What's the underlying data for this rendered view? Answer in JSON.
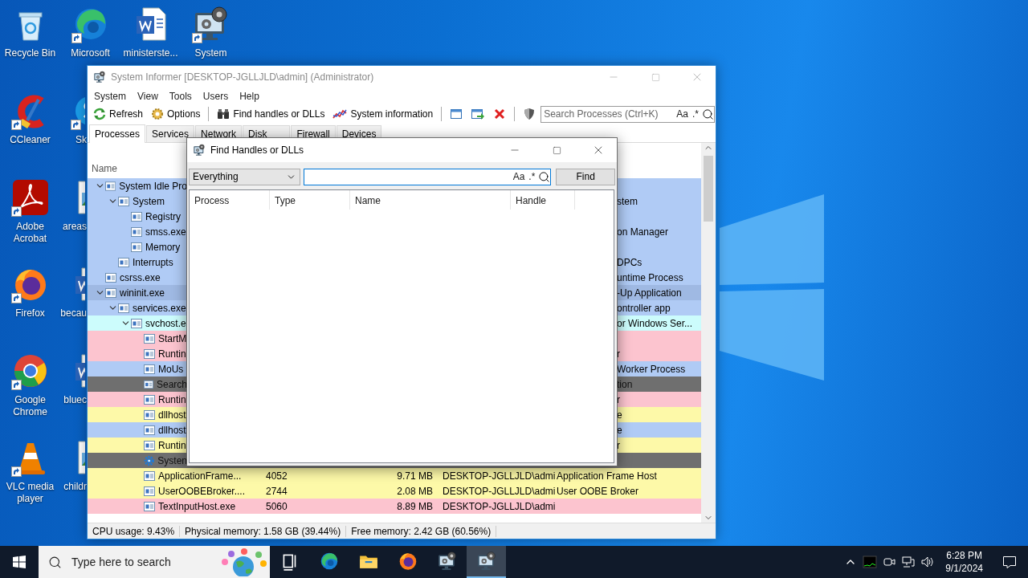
{
  "desktop_columns": [
    [
      {
        "label": "Recycle Bin",
        "kind": "recycle",
        "shortcut": false,
        "partial": false
      },
      {
        "label": "CCleaner",
        "kind": "ccleaner",
        "shortcut": true,
        "partial": false
      },
      {
        "label": "Adobe Acrobat",
        "kind": "acrobat",
        "shortcut": true,
        "partial": false
      },
      {
        "label": "Firefox",
        "kind": "firefox",
        "shortcut": true,
        "partial": false
      },
      {
        "label": "Google Chrome",
        "kind": "chrome",
        "shortcut": true,
        "partial": false
      },
      {
        "label": "VLC media player",
        "kind": "vlc",
        "shortcut": true,
        "partial": false
      }
    ],
    [
      {
        "label": "Microsoft",
        "kind": "edge",
        "shortcut": true,
        "partial": false
      },
      {
        "label": "Sk",
        "kind": "skype",
        "shortcut": true,
        "partial": true
      },
      {
        "label": "areas",
        "kind": "image",
        "shortcut": false,
        "partial": true
      },
      {
        "label": "becau",
        "kind": "word",
        "shortcut": false,
        "partial": true
      },
      {
        "label": "bluec",
        "kind": "word",
        "shortcut": false,
        "partial": true
      },
      {
        "label": "childr",
        "kind": "image",
        "shortcut": false,
        "partial": true
      }
    ],
    [
      {
        "label": "ministerste...",
        "kind": "word",
        "shortcut": false,
        "partial": false
      }
    ],
    [
      {
        "label": "System",
        "kind": "sysinformer",
        "shortcut": true,
        "partial": false
      }
    ]
  ],
  "main_window": {
    "title": "System Informer [DESKTOP-JGLLJLD\\admin] (Administrator)",
    "menu": [
      "System",
      "View",
      "Tools",
      "Users",
      "Help"
    ],
    "toolbar": [
      {
        "kind": "refresh",
        "label": "Refresh"
      },
      {
        "kind": "options",
        "label": "Options"
      },
      {
        "kind": "separator"
      },
      {
        "kind": "find",
        "label": "Find handles or DLLs"
      },
      {
        "kind": "sysinfo",
        "label": "System information"
      },
      {
        "kind": "separator"
      },
      {
        "kind": "window"
      },
      {
        "kind": "window-go"
      },
      {
        "kind": "terminate"
      },
      {
        "kind": "separator"
      },
      {
        "kind": "shield"
      }
    ],
    "search": {
      "placeholder": "Search Processes (Ctrl+K)",
      "options": [
        "Aa",
        ".*"
      ]
    },
    "tabs": [
      {
        "label": "Processes",
        "selected": true
      },
      {
        "label": "Services",
        "selected": false
      },
      {
        "label": "Network",
        "selected": false
      },
      {
        "label": "Disk",
        "selected": false
      },
      {
        "label": "Firewall",
        "selected": false
      },
      {
        "label": "Devices",
        "selected": false
      }
    ],
    "name_column": "Name",
    "processes": [
      {
        "kind": "process",
        "name": "System Idle Pro",
        "color": "#b0cbf5",
        "expanded": true,
        "children": [
          {
            "kind": "process",
            "name": "System",
            "tail": "stem",
            "color": "#b0cbf5",
            "expanded": true,
            "children": [
              {
                "kind": "process",
                "name": "Registry",
                "color": "#b0cbf5"
              },
              {
                "kind": "process",
                "name": "smss.exe",
                "tail": "on Manager",
                "color": "#b0cbf5"
              },
              {
                "kind": "process",
                "name": "Memory",
                "color": "#b0cbf5"
              }
            ]
          },
          {
            "kind": "process",
            "name": "Interrupts",
            "tail": "DPCs",
            "color": "#b0cbf5"
          }
        ]
      },
      {
        "kind": "process",
        "name": "csrss.exe",
        "tail": "untime Process",
        "color": "#b0cbf5"
      },
      {
        "kind": "process",
        "name": "wininit.exe",
        "tail": "-Up Application",
        "color": "#9fb9e3",
        "expanded": true,
        "children": [
          {
            "kind": "process",
            "name": "services.exe",
            "tail": "ontroller app",
            "color": "#b0cbf5",
            "expanded": true,
            "children": [
              {
                "kind": "process",
                "name": "svchost.e",
                "tail": "or Windows Ser...",
                "color": "#ccfcfc",
                "expanded": true,
                "children": [
                  {
                    "kind": "process",
                    "name": "StartM",
                    "color": "#fcc4cf"
                  },
                  {
                    "kind": "process",
                    "name": "Runtin",
                    "tail": "r",
                    "color": "#fcc4cf"
                  },
                  {
                    "kind": "process",
                    "name": "MoUs",
                    "tail": "Worker Process",
                    "color": "#b0cbf5"
                  },
                  {
                    "kind": "process",
                    "name": "Search",
                    "tail": "tion",
                    "color": "#6f6f6f"
                  },
                  {
                    "kind": "process",
                    "name": "Runtin",
                    "tail": "r",
                    "color": "#fcc4cf"
                  },
                  {
                    "kind": "process",
                    "name": "dllhost",
                    "tail": "e",
                    "color": "#fdf9a8"
                  },
                  {
                    "kind": "process",
                    "name": "dllhost",
                    "tail": "e",
                    "color": "#b0cbf5"
                  },
                  {
                    "kind": "process",
                    "name": "Runtin",
                    "tail": "r",
                    "color": "#fdf9a8"
                  },
                  {
                    "kind": "service",
                    "name": "Systen",
                    "color": "#6f6f6f"
                  },
                  {
                    "kind": "process",
                    "name": "ApplicationFrame...",
                    "pid": "4052",
                    "memory": "9.71 MB",
                    "user": "DESKTOP-JGLLJLD\\admi",
                    "description": "Application Frame Host",
                    "color": "#fdf9a8"
                  },
                  {
                    "kind": "process",
                    "name": "UserOOBEBroker....",
                    "pid": "2744",
                    "memory": "2.08 MB",
                    "user": "DESKTOP-JGLLJLD\\admi",
                    "description": "User OOBE Broker",
                    "color": "#fdf9a8"
                  },
                  {
                    "kind": "process",
                    "name": "TextInputHost.exe",
                    "pid": "5060",
                    "memory": "8.89 MB",
                    "user": "DESKTOP-JGLLJLD\\admi",
                    "color": "#fcc4cf"
                  }
                ]
              }
            ]
          }
        ]
      }
    ],
    "status_bar": [
      "CPU usage: 9.43%",
      "Physical memory: 1.58 GB (39.44%)",
      "Free memory: 2.42 GB (60.56%)"
    ]
  },
  "dialog": {
    "title": "Find Handles or DLLs",
    "filter": "Everything",
    "options": [
      "Aa",
      ".*"
    ],
    "find_button": "Find",
    "columns": [
      "Process",
      "Type",
      "Name",
      "Handle"
    ]
  },
  "taskbar": {
    "search_placeholder": "Type here to search",
    "apps": [
      {
        "kind": "taskview",
        "selected": false
      },
      {
        "kind": "edge",
        "selected": false
      },
      {
        "kind": "explorer",
        "selected": false
      },
      {
        "kind": "firefox",
        "selected": false
      },
      {
        "kind": "sysinformer",
        "selected": false
      },
      {
        "kind": "sysinformer",
        "selected": true
      }
    ],
    "time": "6:28 PM",
    "date": "9/1/2024"
  }
}
